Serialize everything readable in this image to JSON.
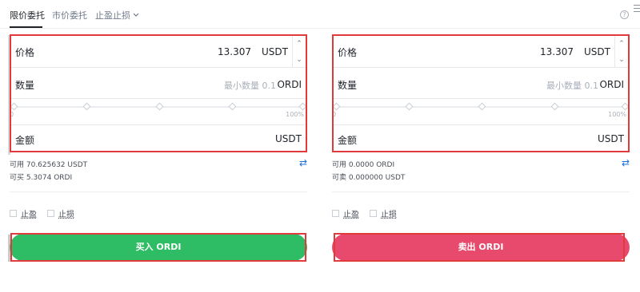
{
  "tabs": {
    "limit": "限价委托",
    "market": "市价委托",
    "tpsl": "止盈止损",
    "help_icon": "help-icon",
    "menu_icon": "menu-icon"
  },
  "buy": {
    "price_label": "价格",
    "price_value": "13.307",
    "price_unit": "USDT",
    "qty_label": "数量",
    "qty_placeholder": "最小数量 0.1",
    "qty_unit": "ORDI",
    "slider_min": "0",
    "slider_max": "100%",
    "total_label": "金额",
    "total_unit": "USDT",
    "available": "可用 70.625632 USDT",
    "can_buy": "可买 5.3074 ORDI",
    "take_profit": "止盈",
    "stop_loss": "止损",
    "button": "买入 ORDI"
  },
  "sell": {
    "price_label": "价格",
    "price_value": "13.307",
    "price_unit": "USDT",
    "qty_label": "数量",
    "qty_placeholder": "最小数量 0.1",
    "qty_unit": "ORDI",
    "slider_min": "0",
    "slider_max": "100%",
    "total_label": "金额",
    "total_unit": "USDT",
    "available": "可用 0.0000 ORDI",
    "can_sell": "可卖 0.000000 USDT",
    "take_profit": "止盈",
    "stop_loss": "止损",
    "button": "卖出 ORDI"
  },
  "colors": {
    "buy": "#2ebd64",
    "sell": "#e84a6e",
    "highlight": "#e03a3a",
    "accent": "#1e6fd9"
  },
  "slider": {
    "value_percent": 0
  }
}
